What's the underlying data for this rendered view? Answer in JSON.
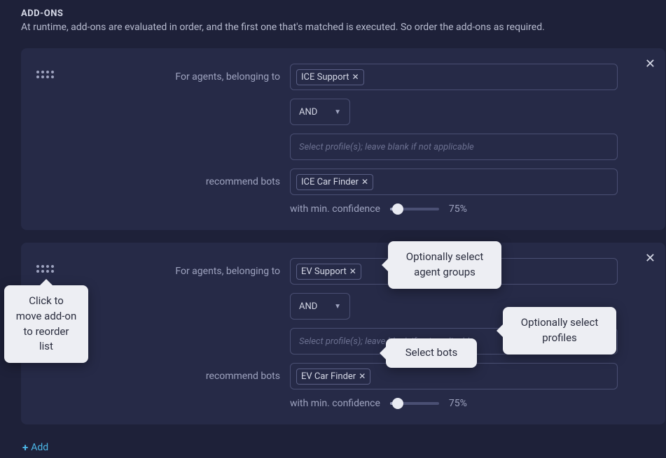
{
  "section": {
    "title": "ADD-ONS",
    "description": "At runtime, add-ons are evaluated in order, and the first one that's matched is executed. So order the add-ons as required."
  },
  "labels": {
    "for_agents": "For agents, belonging to",
    "recommend_bots": "recommend bots",
    "min_confidence": "with min. confidence",
    "profile_placeholder": "Select profile(s); leave blank if not applicable"
  },
  "logic": {
    "value": "AND"
  },
  "cards": [
    {
      "agent_tag": "ICE Support",
      "bot_tag": "ICE Car Finder",
      "confidence": "75%"
    },
    {
      "agent_tag": "EV Support",
      "bot_tag": "EV Car Finder",
      "confidence": "75%"
    }
  ],
  "add_button": "Add",
  "tooltips": {
    "drag": "Click to move add-on to reorder list",
    "agent_groups": "Optionally select agent groups",
    "profiles": "Optionally select profiles",
    "bots": "Select bots"
  }
}
